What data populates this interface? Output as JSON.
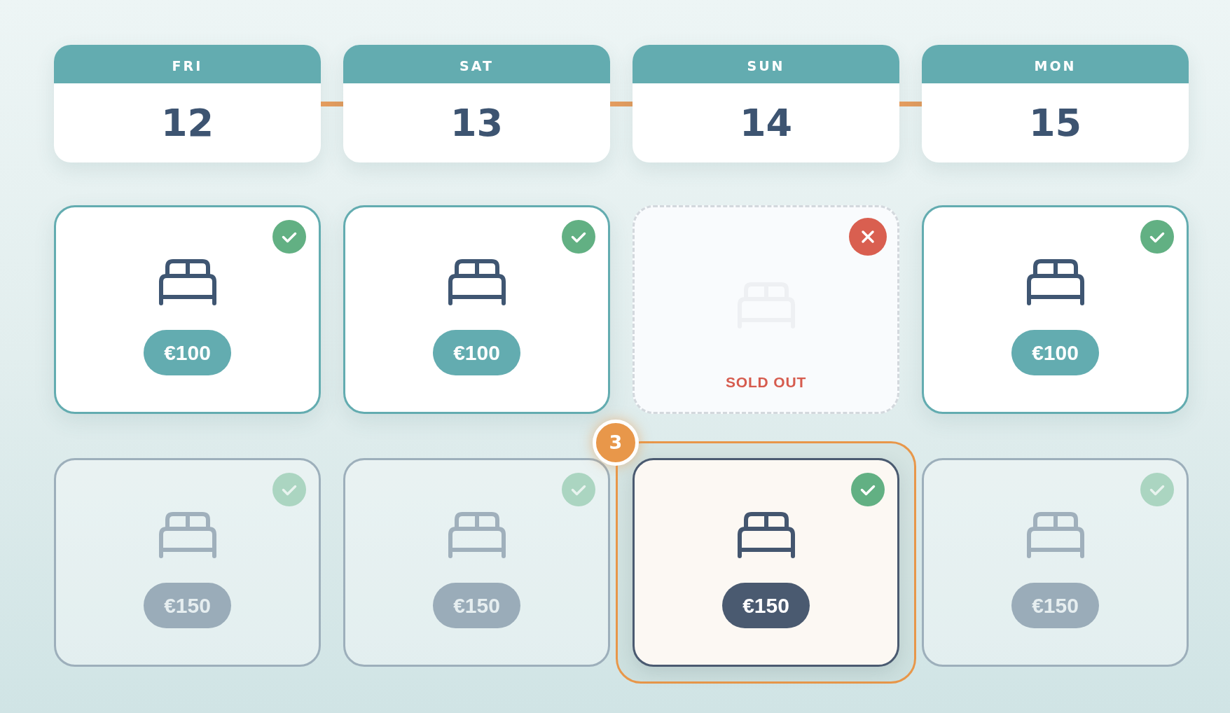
{
  "days": [
    {
      "weekday": "FRI",
      "date": "12"
    },
    {
      "weekday": "SAT",
      "date": "13"
    },
    {
      "weekday": "SUN",
      "date": "14"
    },
    {
      "weekday": "MON",
      "date": "15"
    }
  ],
  "rows": [
    {
      "slots": [
        {
          "kind": "available",
          "price": "€100",
          "selected": false,
          "dimmed": false
        },
        {
          "kind": "available",
          "price": "€100",
          "selected": false,
          "dimmed": false
        },
        {
          "kind": "sold_out",
          "label": "SOLD OUT",
          "selected": false,
          "dimmed": false
        },
        {
          "kind": "available",
          "price": "€100",
          "selected": false,
          "dimmed": false
        }
      ]
    },
    {
      "slots": [
        {
          "kind": "available",
          "price": "€150",
          "selected": false,
          "dimmed": true
        },
        {
          "kind": "available",
          "price": "€150",
          "selected": false,
          "dimmed": true
        },
        {
          "kind": "available",
          "price": "€150",
          "selected": true,
          "dimmed": false,
          "badge": "3"
        },
        {
          "kind": "available",
          "price": "€150",
          "selected": false,
          "dimmed": true
        }
      ]
    }
  ]
}
